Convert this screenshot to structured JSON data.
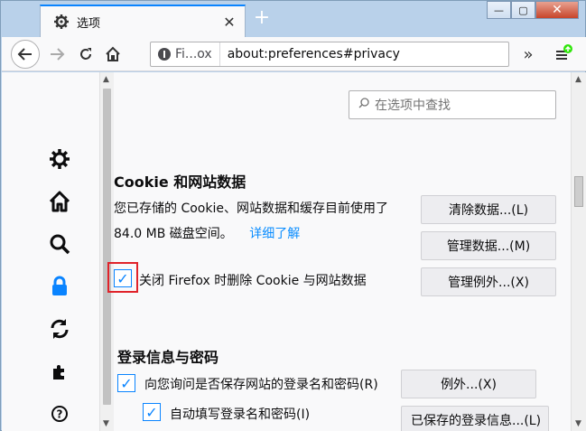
{
  "tab": {
    "title": "选项"
  },
  "nav": {
    "identity_label": "Fi...ox",
    "url": "about:preferences#privacy"
  },
  "search": {
    "placeholder": "在选项中查找"
  },
  "cookie_section": {
    "heading": "Cookie 和网站数据",
    "usage_line1": "您已存储的 Cookie、网站数据和缓存目前使用了",
    "usage_line2": "84.0 MB 磁盘空间。",
    "learn_more": "详细了解",
    "clear_button": "清除数据...(L)",
    "manage_button": "管理数据...(M)",
    "exceptions_button": "管理例外...(X)",
    "delete_on_close_label": "关闭 Firefox 时删除 Cookie 与网站数据",
    "delete_on_close_checked": true
  },
  "logins_section": {
    "heading": "登录信息与密码",
    "ask_save_label": "向您询问是否保存网站的登录名和密码(R)",
    "ask_save_checked": true,
    "autofill_label": "自动填写登录名和密码(I)",
    "autofill_checked": true,
    "exceptions_button": "例外...(X)",
    "saved_logins_button": "已保存的登录信息...(L)"
  },
  "sidebar_icons": [
    "gear-icon",
    "home-icon",
    "search-icon",
    "lock-icon",
    "sync-icon",
    "extension-icon",
    "help-icon"
  ],
  "colors": {
    "accent": "#0a84ff",
    "highlight_box": "#e0232a"
  }
}
